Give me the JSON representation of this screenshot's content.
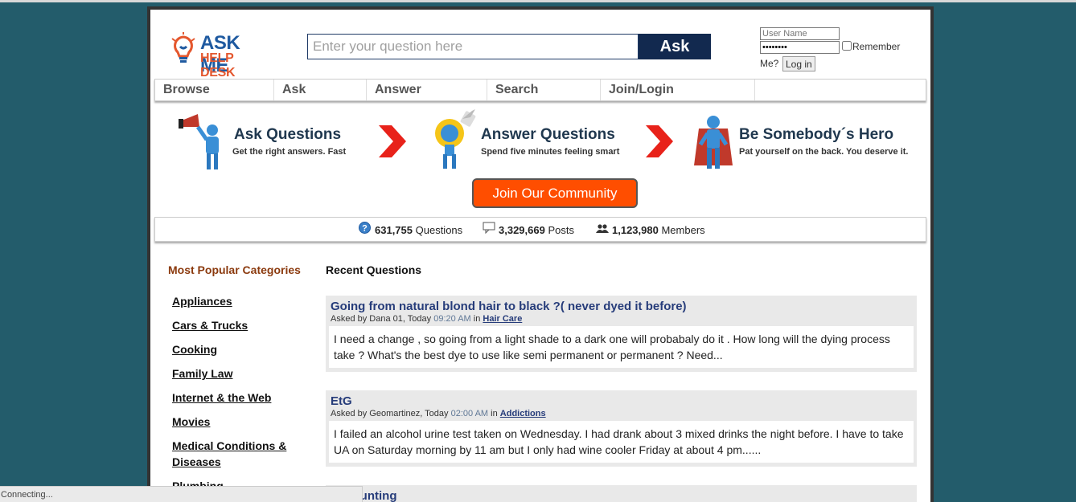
{
  "logo": {
    "line1": "ASK ME",
    "line2": "HELP DESK"
  },
  "search": {
    "placeholder": "Enter your question here",
    "button": "Ask"
  },
  "login": {
    "username_placeholder": "User Name",
    "password_value": "••••••••",
    "remember_label": "Remember",
    "me_label": "Me?",
    "login_button": "Log in"
  },
  "nav": {
    "items": [
      "Browse",
      "Ask",
      "Answer",
      "Search",
      "Join/Login"
    ]
  },
  "hero": [
    {
      "title": "Ask Questions",
      "subtitle": "Get the right answers. Fast"
    },
    {
      "title": "Answer Questions",
      "subtitle": "Spend five minutes feeling smart"
    },
    {
      "title": "Be Somebody´s Hero",
      "subtitle": "Pat yourself on the back. You deserve it."
    }
  ],
  "join_button": "Join Our Community",
  "stats": {
    "questions": {
      "value": "631,755",
      "label": "Questions"
    },
    "posts": {
      "value": "3,329,669",
      "label": "Posts"
    },
    "members": {
      "value": "1,123,980",
      "label": "Members"
    }
  },
  "categories": {
    "heading": "Most Popular Categories",
    "items": [
      "Appliances",
      "Cars & Trucks",
      "Cooking",
      "Family Law",
      "Internet & the Web",
      "Movies",
      "Medical Conditions & Diseases",
      "Plumbing"
    ]
  },
  "recent": {
    "heading": "Recent Questions",
    "questions": [
      {
        "title": "Going from natural blond hair to black ?( never dyed it before)",
        "meta_prefix": "Asked by Dana 01, Today ",
        "time": "09:20 AM",
        "meta_in": " in ",
        "category": "Hair Care",
        "body": "I need a change , so going from a light shade to a dark one will probabaly do it . How long will the dying process take ? What's the best dye to use like semi permanent or permanent ? Need..."
      },
      {
        "title": "EtG",
        "meta_prefix": "Asked by Geomartinez, Today ",
        "time": "02:00 AM",
        "meta_in": " in ",
        "category": "Addictions",
        "body": "I failed an alcohol urine test taken on Wednesday. I had drank about 3 mixed drinks the night before. I have to take UA on Saturday morning by 11 am but I only had wine cooler Friday at about 4 pm......"
      },
      {
        "title": "Accounting"
      }
    ]
  },
  "status_bar": "Connecting...",
  "colors": {
    "background": "#235c6b",
    "accent": "#ff4e00",
    "nav_dark": "#12294f",
    "link": "#263c7a"
  }
}
